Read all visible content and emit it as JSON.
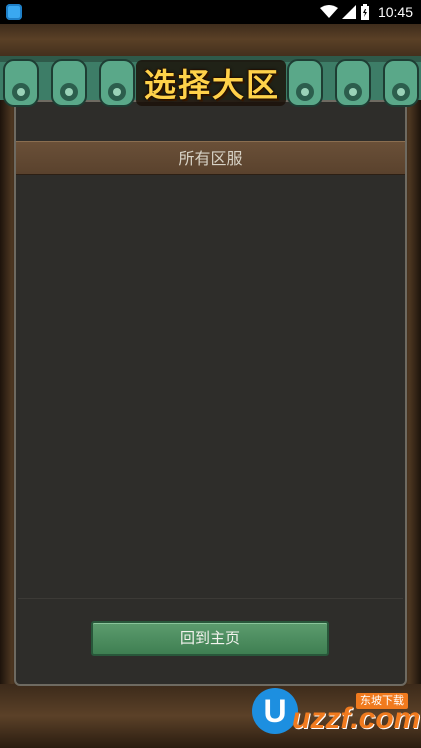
{
  "status_bar": {
    "time": "10:45",
    "icons": [
      "app-notification-icon",
      "wifi-icon",
      "signal-icon",
      "battery-icon"
    ]
  },
  "screen": {
    "title": "选择大区",
    "section_header": "所有区服",
    "home_button_label": "回到主页"
  },
  "watermark": {
    "logo_text": "uzzf.com",
    "tag": "东坡下载"
  },
  "colors": {
    "panel_bg": "#2e2d2a",
    "header_bg": "#5a422d",
    "button_green": "#4a8a5c",
    "title_gold": "#ffd24a",
    "roof_green": "#4e9a80"
  }
}
